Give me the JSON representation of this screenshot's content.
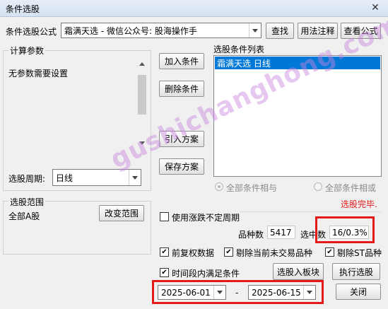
{
  "window": {
    "title": "条件选股",
    "close_glyph": "✕"
  },
  "formula": {
    "label": "条件选股公式",
    "value": "霜满天选  -  微信公众号: 股海操作手",
    "find_button": "查找",
    "usage_button": "用法注释",
    "view_button": "查看公式"
  },
  "params": {
    "group_label": "计算参数",
    "text": "无参数需要设置"
  },
  "actions": {
    "add": "加入条件",
    "delete": "删除条件",
    "import": "引入方案",
    "save": "保存方案"
  },
  "conditions": {
    "label": "选股条件列表",
    "items": [
      "霜满天选  日线"
    ]
  },
  "period": {
    "label": "选股周期:",
    "value": "日线"
  },
  "logic": {
    "and_label": "全部条件相与",
    "or_label": "全部条件相或"
  },
  "status": {
    "text": "选股完毕.",
    "color": "#e41a1a"
  },
  "range": {
    "group_label": "选股范围",
    "value": "全部A股",
    "change_button": "改变范围"
  },
  "stats": {
    "use_limit_label": "使用涨跌不定周期",
    "count_label": "品种数",
    "count_value": "5417",
    "selected_label": "选中数",
    "selected_value": "16/0.3%"
  },
  "options": {
    "fq_label": "前复权数据",
    "exclude_untraded_label": "剔除当前未交易品种",
    "exclude_st_label": "剔除ST品种",
    "time_cond_label": "时间段内满足条件"
  },
  "buttons": {
    "to_block": "选股入板块",
    "run": "执行选股",
    "close": "关闭"
  },
  "dates": {
    "start": "2025-06-01",
    "separator": "-",
    "end": "2025-06-15"
  },
  "watermark": "gushichanghong.com",
  "accent_highlight": "#0078d7"
}
